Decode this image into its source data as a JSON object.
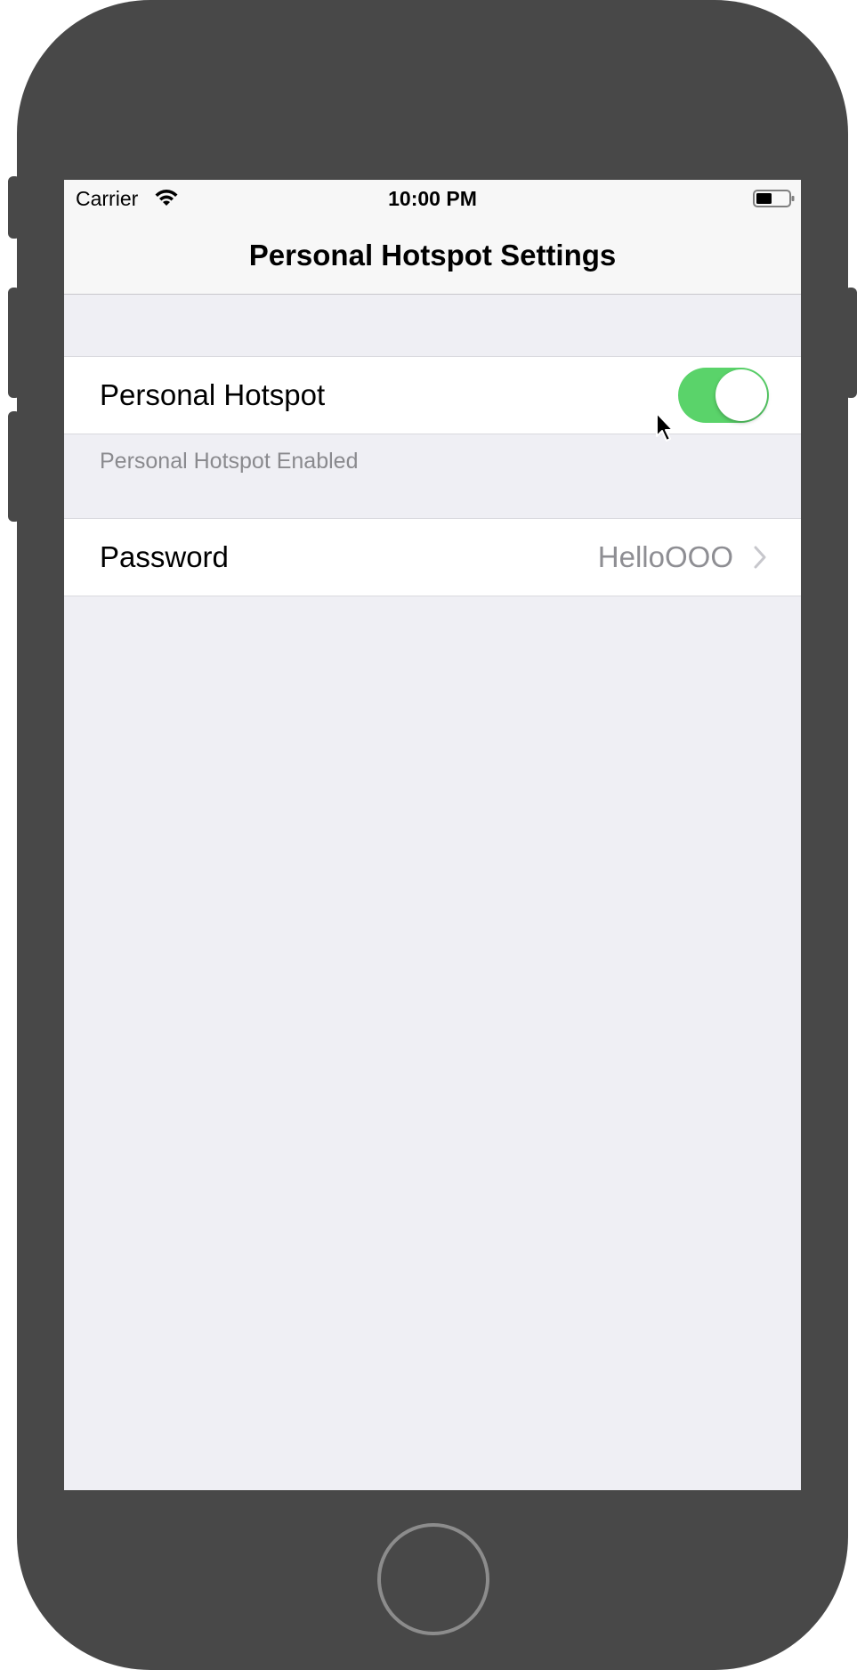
{
  "status_bar": {
    "carrier": "Carrier",
    "time": "10:00 PM",
    "wifi_icon": "wifi-icon",
    "battery_icon": "battery-icon"
  },
  "nav": {
    "title": "Personal Hotspot Settings"
  },
  "hotspot_cell": {
    "label": "Personal Hotspot",
    "toggle_on": true,
    "toggle_color": "#5ad36a"
  },
  "hotspot_footer": "Personal Hotspot Enabled",
  "password_cell": {
    "label": "Password",
    "value": "HelloOOO",
    "accessory_icon": "chevron-right-icon"
  },
  "colors": {
    "background": "#efeff4",
    "device": "#484848"
  }
}
